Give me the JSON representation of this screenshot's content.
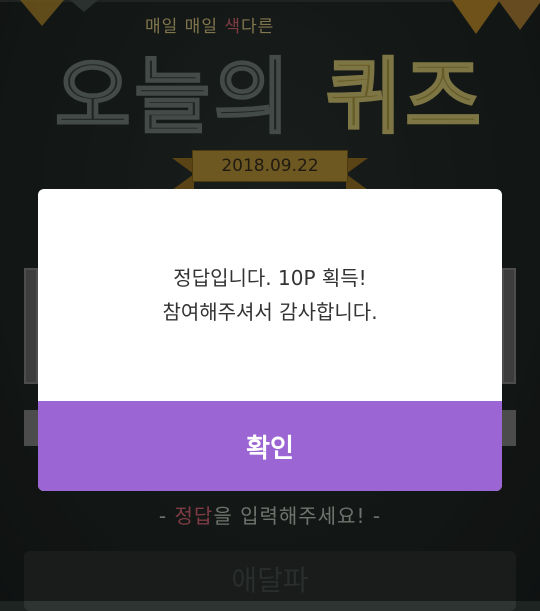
{
  "header": {
    "subtitle_a": "매일 매일 ",
    "subtitle_accent": "색",
    "subtitle_b": "다른",
    "title_a": "오늘의 ",
    "title_accent": "퀴즈",
    "date": "2018.09.22"
  },
  "quiz": {
    "hint_a": "- ",
    "hint_accent": "정답",
    "hint_b": "을 입력해주세요! -",
    "answer_value": "애달파"
  },
  "modal": {
    "line1": "정답입니다. 10P 획득!",
    "line2": "참여해주셔서 감사합니다.",
    "confirm_label": "확인"
  },
  "colors": {
    "accent": "#9b66d3",
    "board": "#252d2a"
  }
}
